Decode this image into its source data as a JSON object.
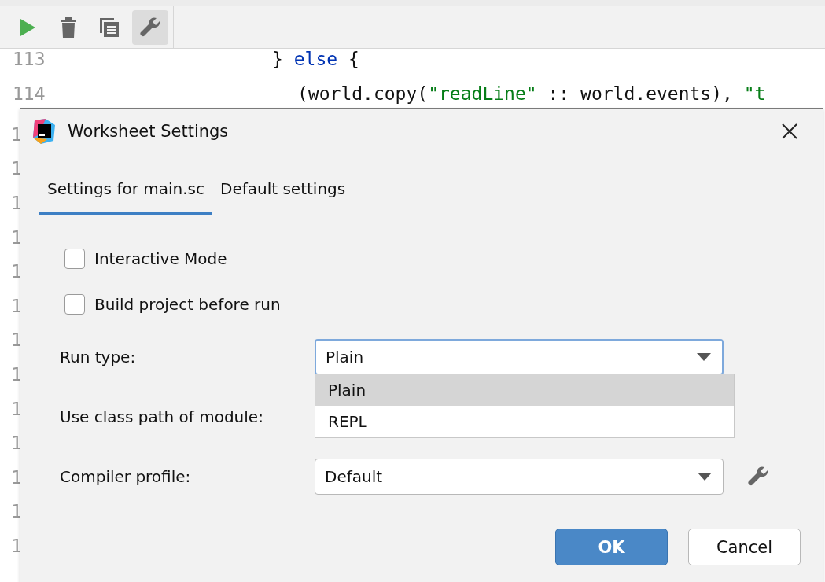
{
  "toolbar": {
    "buttons": [
      {
        "kind": "run",
        "selected": false
      },
      {
        "kind": "delete",
        "selected": false
      },
      {
        "kind": "copy",
        "selected": false
      },
      {
        "kind": "settings",
        "selected": true
      }
    ]
  },
  "editor": {
    "lines": [
      {
        "number": "113",
        "tokens": [
          {
            "text": "} ",
            "kind": "plain"
          },
          {
            "text": "else",
            "kind": "keyword"
          },
          {
            "text": " {",
            "kind": "plain"
          }
        ]
      },
      {
        "number": "114",
        "tokens": [
          {
            "text": "(world.copy(",
            "kind": "plain"
          },
          {
            "text": "\"readLine\"",
            "kind": "string"
          },
          {
            "text": " :: world.events), ",
            "kind": "plain"
          },
          {
            "text": "\"t",
            "kind": "string"
          }
        ]
      }
    ],
    "hidden_line_numbers": [
      "1",
      "1",
      "1",
      "1",
      "1",
      "1",
      "1",
      "1",
      "1",
      "1",
      "1",
      "1",
      "1"
    ]
  },
  "dialog": {
    "title": "Worksheet Settings",
    "tabs": [
      {
        "label": "Settings for main.sc",
        "selected": true
      },
      {
        "label": "Default settings",
        "selected": false
      }
    ],
    "checkboxes": [
      {
        "label": "Interactive Mode",
        "checked": false
      },
      {
        "label": "Build project before run",
        "checked": false
      }
    ],
    "run_type": {
      "label": "Run type:",
      "value": "Plain",
      "expanded": true,
      "options": [
        {
          "label": "Plain",
          "selected": true
        },
        {
          "label": "REPL",
          "selected": false
        }
      ]
    },
    "class_path": {
      "label": "Use class path of module:"
    },
    "compiler_profile": {
      "label": "Compiler profile:",
      "value": "Default"
    },
    "buttons": [
      {
        "label": "OK",
        "kind": "primary"
      },
      {
        "label": "Cancel",
        "kind": "secondary"
      }
    ]
  }
}
